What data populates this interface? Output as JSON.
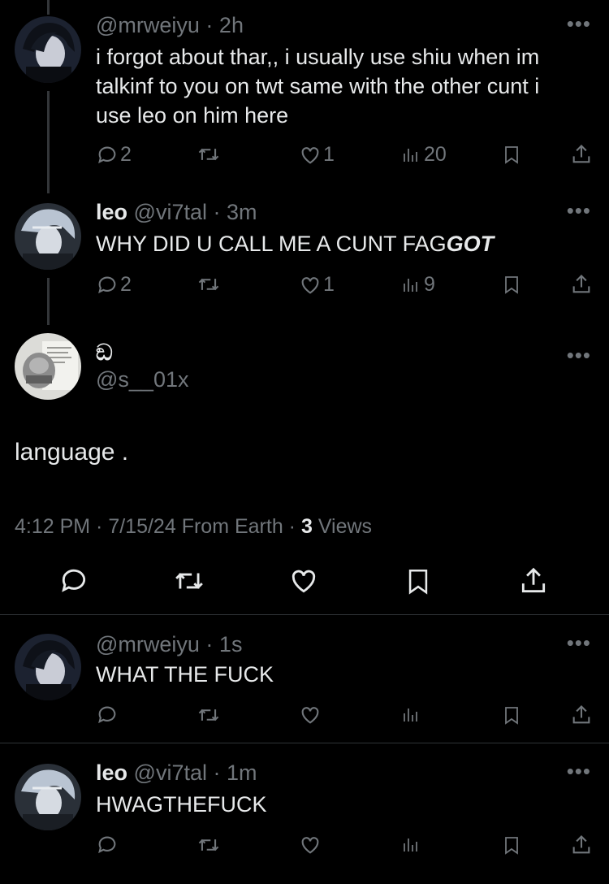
{
  "replies_above": [
    {
      "name": "",
      "handle": "@mrweiyu",
      "time": "2h",
      "text_lines": [
        "i forgot about thar,, i usually use shiu when im",
        "talkinf to you on twt same with the other cunt i",
        "use leo on him here"
      ],
      "replies": "2",
      "likes": "1",
      "views": "20"
    },
    {
      "name": "leo",
      "handle": "@vi7tal",
      "time": "3m",
      "text_plain": "WHY DID U CALL ME A CUNT FAG",
      "text_bold": "GOT",
      "replies": "2",
      "likes": "1",
      "views": "9"
    }
  ],
  "main_post": {
    "name": "ඞ",
    "handle": "@s__01x",
    "text": "language .",
    "time": "4:12 PM",
    "date": "7/15/24",
    "source": "From Earth",
    "views_count": "3",
    "views_label": "Views"
  },
  "replies_below": [
    {
      "name": "",
      "handle": "@mrweiyu",
      "time": "1s",
      "text": "WHAT THE FUCK"
    },
    {
      "name": "leo",
      "handle": "@vi7tal",
      "time": "1m",
      "text": "HWAGTHEFUCK"
    }
  ],
  "icons": {
    "more": "more-icon",
    "reply": "reply-icon",
    "repost": "repost-icon",
    "like": "like-icon",
    "views": "views-icon",
    "bookmark": "bookmark-icon",
    "share": "share-icon"
  },
  "colors": {
    "background": "#000000",
    "text": "#e7e9ea",
    "muted": "#71767b",
    "line": "#333639"
  }
}
